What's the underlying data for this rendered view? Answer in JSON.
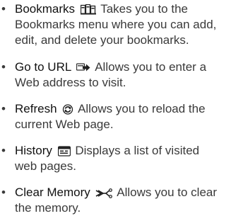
{
  "features": [
    {
      "name": "Bookmarks",
      "icon": "bookmarks-icon",
      "desc_line1": "Takes you to the",
      "desc_rest": [
        "Bookmarks menu where you can add,",
        "edit, and delete your bookmarks."
      ]
    },
    {
      "name": "Go to URL",
      "icon": "go-to-url-icon",
      "desc_line1": "Allows you to enter a",
      "desc_rest": [
        "Web address to visit."
      ]
    },
    {
      "name": "Refresh",
      "icon": "refresh-icon",
      "desc_line1": "Allows you to reload the",
      "desc_rest": [
        "current Web page."
      ]
    },
    {
      "name": "History",
      "icon": "history-icon",
      "desc_line1": "Displays a list of visited",
      "desc_rest": [
        "web pages."
      ]
    },
    {
      "name": "Clear Memory",
      "icon": "clear-memory-icon",
      "desc_line1": "Allows you to clear",
      "desc_rest": [
        "the memory."
      ]
    }
  ],
  "bullet_char": "•"
}
